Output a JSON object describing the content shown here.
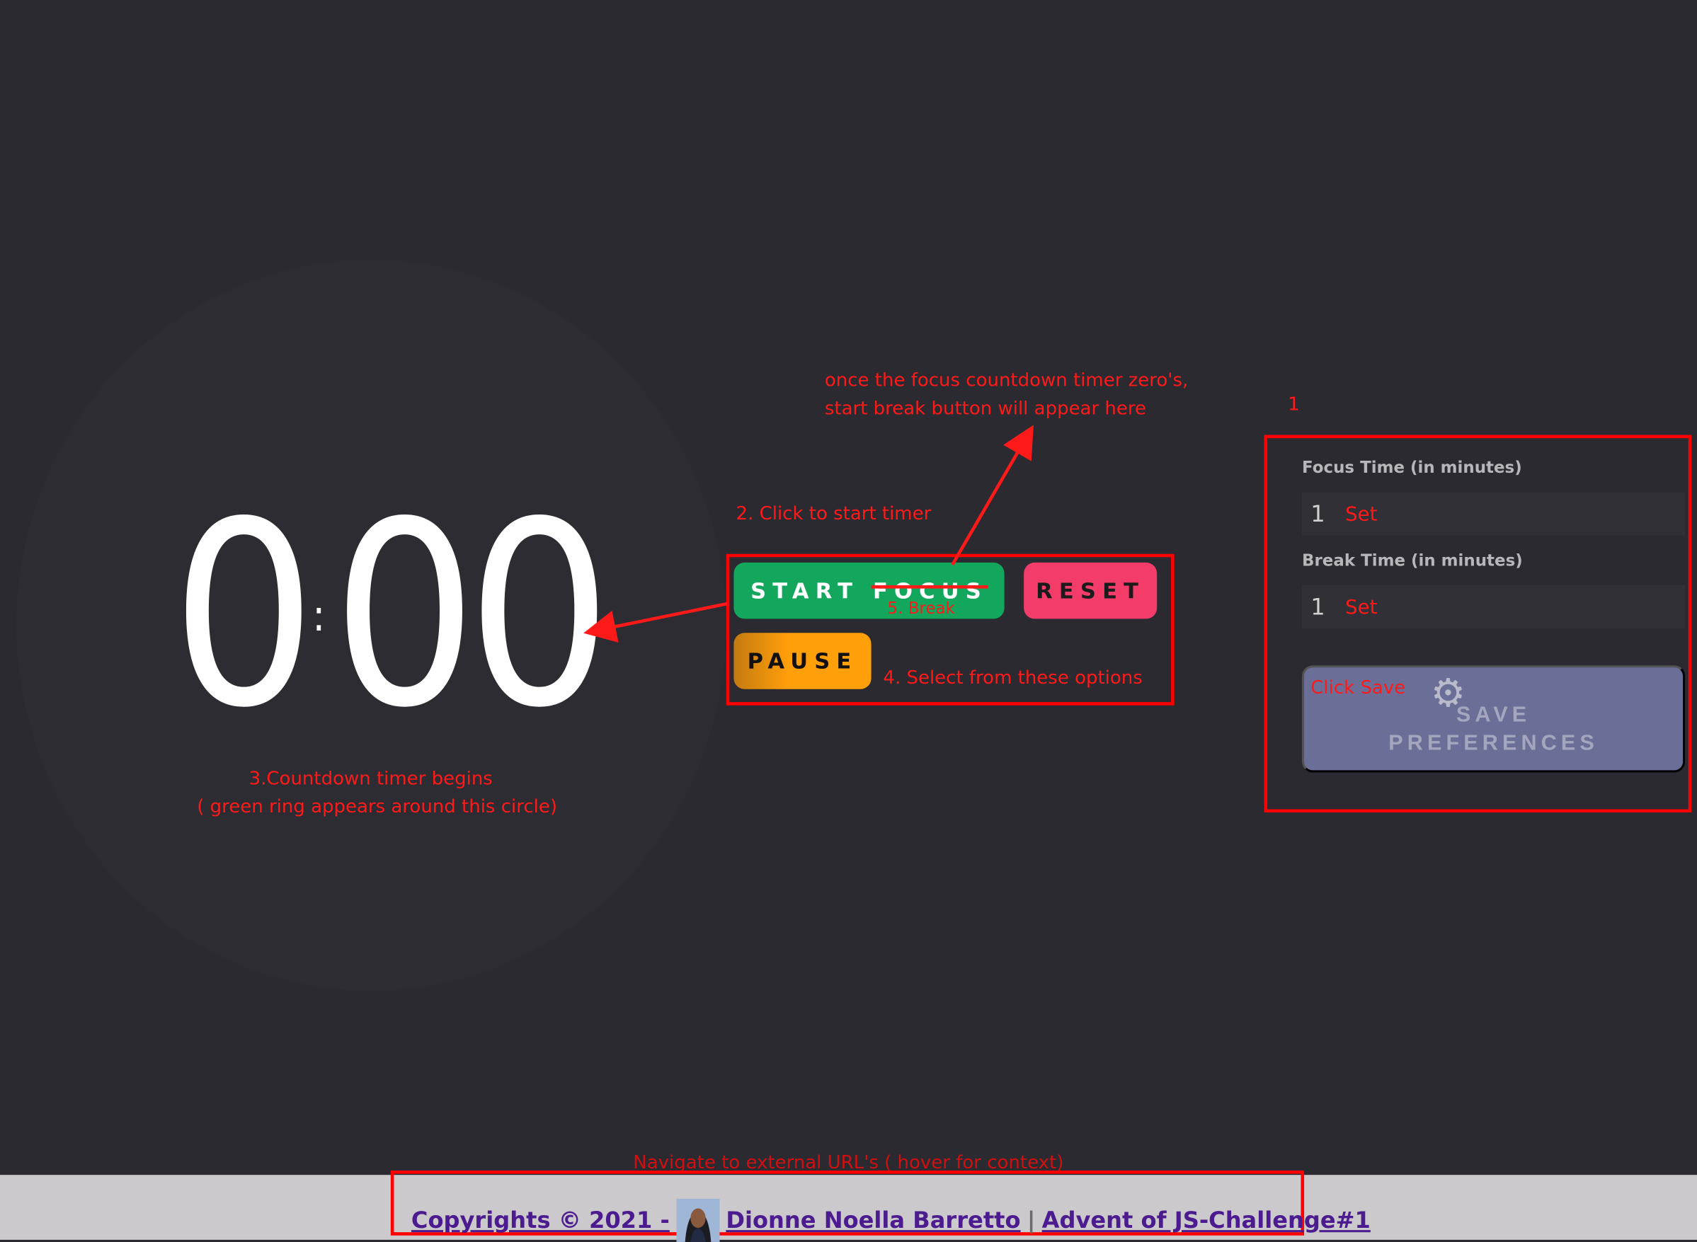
{
  "timer": {
    "minutes": "0",
    "colon": ":",
    "seconds": "00"
  },
  "controls": {
    "start_label": "START FOCUS",
    "reset_label": "RESET",
    "pause_label": "PAUSE"
  },
  "settings": {
    "focus_label": "Focus Time (in minutes)",
    "focus_value": "1",
    "focus_set": "Set",
    "break_label": "Break Time (in minutes)",
    "break_value": "1",
    "break_set": "Set",
    "save_line1": "SAVE",
    "save_line2": "PREFERENCES",
    "gear_icon": "gear-icon"
  },
  "annotations": {
    "n1": "1",
    "n2": "2. Click to start timer",
    "n3a": "3.Countdown timer begins",
    "n3b": "( green ring appears around this circle)",
    "n4": "4. Select from these options",
    "n5": "5. Break",
    "top_a": "once the focus countdown timer zero's,",
    "top_b": "start break button will appear here",
    "click_save": "Click Save",
    "navigate": "Navigate to external URL's ( hover for context)"
  },
  "footer": {
    "copyright": "Copyrights © 2021 -",
    "author": " Dionne Noella Barretto",
    "separator": "|",
    "challenge": "Advent of JS-Challenge#1"
  },
  "colors": {
    "background": "#2b2a30",
    "start": "#13a75e",
    "reset": "#f43c6b",
    "pause": "#ff9f0a",
    "save": "#6b6f98",
    "annotation": "#ff0000",
    "footer_bg": "#cbc9cb",
    "footer_link": "#4b1b8f"
  }
}
